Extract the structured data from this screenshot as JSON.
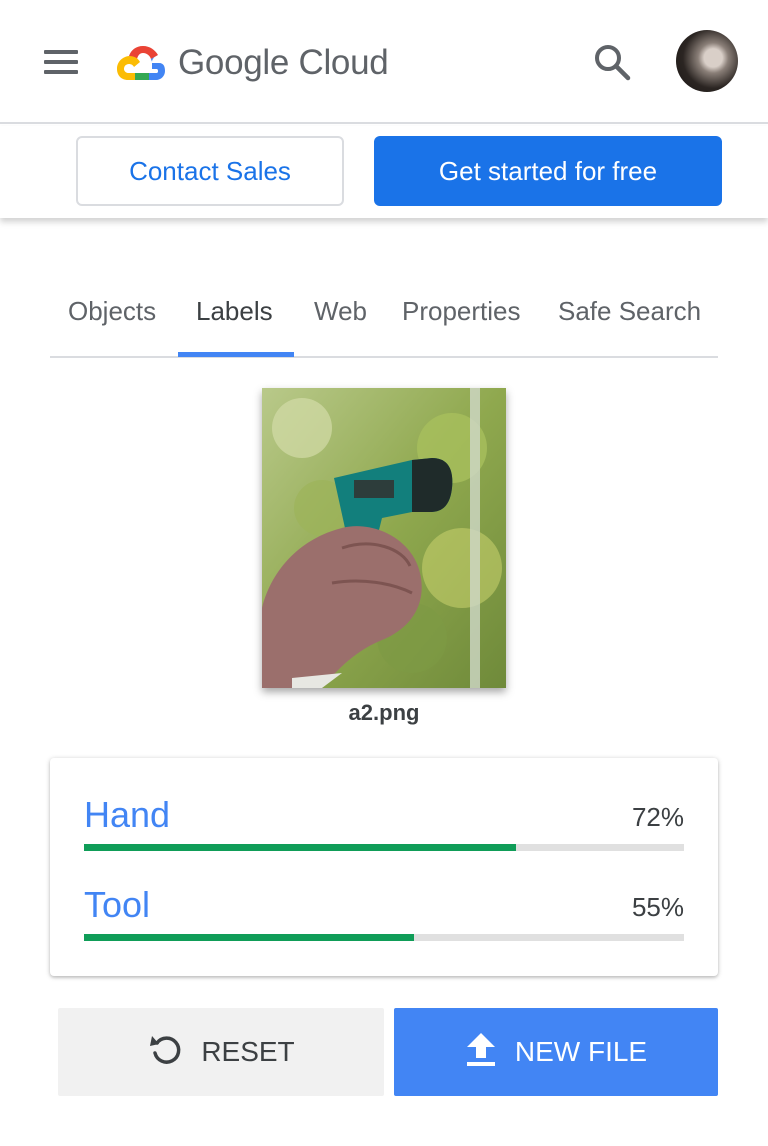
{
  "header": {
    "brand": "Google Cloud",
    "icons": {
      "menu": "menu-icon",
      "search": "search-icon",
      "logo": "google-cloud-logo"
    }
  },
  "actions": {
    "contact_sales": "Contact Sales",
    "get_started": "Get started for free"
  },
  "tabs": [
    {
      "label": "Objects",
      "active": false
    },
    {
      "label": "Labels",
      "active": true
    },
    {
      "label": "Web",
      "active": false
    },
    {
      "label": "Properties",
      "active": false
    },
    {
      "label": "Safe Search",
      "active": false
    }
  ],
  "preview": {
    "filename": "a2.png"
  },
  "labels": [
    {
      "name": "Hand",
      "score": "72%",
      "fraction": 0.72
    },
    {
      "name": "Tool",
      "score": "55%",
      "fraction": 0.55
    }
  ],
  "buttons": {
    "reset": "RESET",
    "new_file": "NEW FILE"
  },
  "colors": {
    "primary": "#1a73e8",
    "accent_blue": "#4285f4",
    "bar_fill": "#0f9d58",
    "bar_track": "#e0e0e0",
    "text": "#3c4043"
  }
}
